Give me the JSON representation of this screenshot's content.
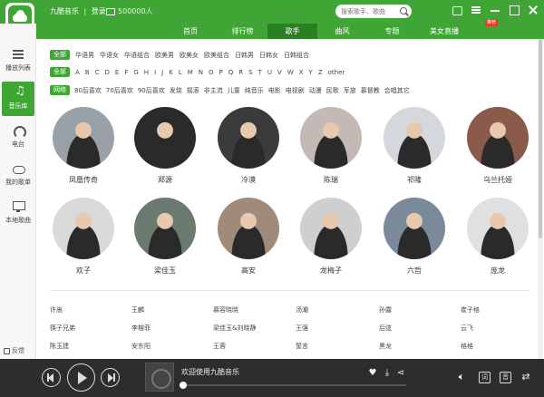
{
  "header": {
    "app_name": "九酷音乐",
    "separator": "|",
    "login": "登录",
    "coins": "500000人",
    "search_placeholder": "搜索歌手、歌曲"
  },
  "nav": {
    "tabs": [
      {
        "label": "首页"
      },
      {
        "label": "排行榜"
      },
      {
        "label": "歌手"
      },
      {
        "label": "曲风"
      },
      {
        "label": "专题"
      },
      {
        "label": "美女直播"
      }
    ],
    "active_tab": "歌手",
    "hot_badge": "推荐"
  },
  "sidebar": {
    "items": [
      {
        "label": "播放列表",
        "icon": "list-icon"
      },
      {
        "label": "音乐库",
        "icon": "music-note-icon"
      },
      {
        "label": "电台",
        "icon": "radio-icon"
      },
      {
        "label": "我的歌单",
        "icon": "cloud-icon"
      },
      {
        "label": "本地歌曲",
        "icon": "monitor-icon"
      }
    ],
    "active": "音乐库",
    "feedback": "反馈"
  },
  "filters": {
    "region": {
      "chip": "全部",
      "options": [
        "华语男",
        "华语女",
        "华语组合",
        "欧美男",
        "欧美女",
        "欧美组合",
        "日韩男",
        "日韩女",
        "日韩组合"
      ]
    },
    "letters": {
      "chip": "全部",
      "options": [
        "A",
        "B",
        "C",
        "D",
        "E",
        "F",
        "G",
        "H",
        "I",
        "J",
        "K",
        "L",
        "M",
        "N",
        "O",
        "P",
        "Q",
        "R",
        "S",
        "T",
        "U",
        "V",
        "W",
        "X",
        "Y",
        "Z",
        "other"
      ]
    },
    "genre": {
      "chip": "网络",
      "options": [
        "80后喜欢",
        "70后喜欢",
        "90后喜欢",
        "发烧",
        "摇滚",
        "非主流",
        "儿童",
        "纯音乐",
        "电影",
        "电视剧",
        "动漫",
        "民歌",
        "军旅",
        "慕督教",
        "合唱其它"
      ]
    }
  },
  "singers": [
    {
      "name": "凤凰传奇",
      "bg": "#9aa0a8"
    },
    {
      "name": "郑源",
      "bg": "#2a2a2a"
    },
    {
      "name": "冷漠",
      "bg": "#3b3b3e"
    },
    {
      "name": "陈瑞",
      "bg": "#c4b9b4"
    },
    {
      "name": "祁隆",
      "bg": "#d4d8dc"
    },
    {
      "name": "乌兰托娅",
      "bg": "#8a5a4a"
    },
    {
      "name": "欢子",
      "bg": "#d9d9d9"
    },
    {
      "name": "梁佳玉",
      "bg": "#6a7a6e"
    },
    {
      "name": "高安",
      "bg": "#a08a7a"
    },
    {
      "name": "龙梅子",
      "bg": "#cfcfcf"
    },
    {
      "name": "六哲",
      "bg": "#7a8a9a"
    },
    {
      "name": "庞龙",
      "bg": "#e0e0e0"
    }
  ],
  "name_list": [
    [
      "许嵩",
      "王麟",
      "慕容晓晓",
      "汤潮",
      "孙露",
      "崔子格"
    ],
    [
      "筷子兄弟",
      "李榕菲",
      "梁佳玉&刘晓静",
      "王强",
      "后弦",
      "云飞"
    ],
    [
      "陈玉建",
      "安东阳",
      "王蓉",
      "誓言",
      "黑龙",
      "格格"
    ]
  ],
  "player": {
    "now_playing": "欢迎使用九酷音乐",
    "progress": 0,
    "lyric_btn": "词",
    "sound_btn": "音"
  }
}
